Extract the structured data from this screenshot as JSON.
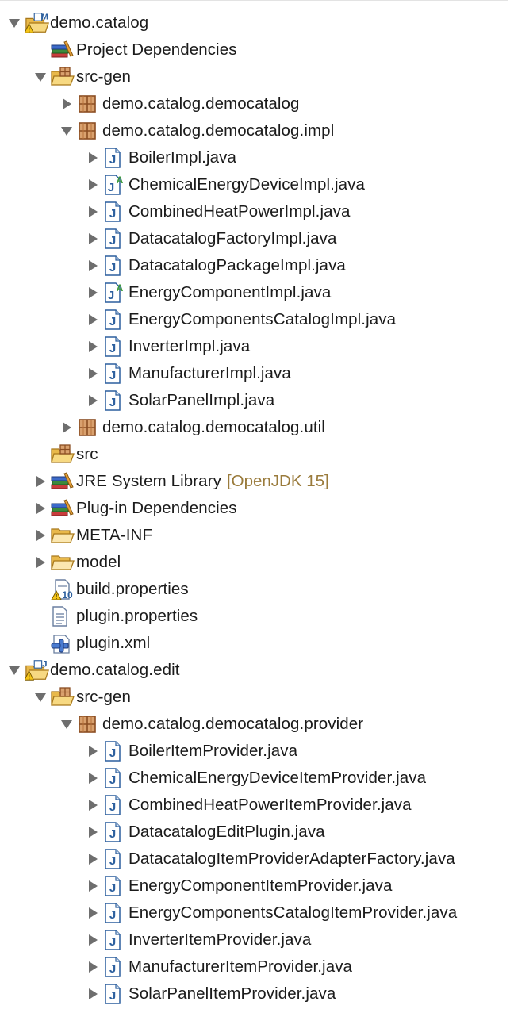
{
  "tree": {
    "rows": [
      {
        "depth": 0,
        "state": "open",
        "icon": "plugin-project-warning-m-icon",
        "label": "demo.catalog"
      },
      {
        "depth": 1,
        "state": "none",
        "icon": "library-icon",
        "label": "Project Dependencies"
      },
      {
        "depth": 1,
        "state": "open",
        "icon": "source-folder-open-icon",
        "label": "src-gen"
      },
      {
        "depth": 2,
        "state": "closed",
        "icon": "package-icon",
        "label": "demo.catalog.democatalog"
      },
      {
        "depth": 2,
        "state": "open",
        "icon": "package-icon",
        "label": "demo.catalog.democatalog.impl"
      },
      {
        "depth": 3,
        "state": "closed",
        "icon": "java-file-icon",
        "label": "BoilerImpl.java"
      },
      {
        "depth": 3,
        "state": "closed",
        "icon": "java-abstract-file-icon",
        "label": "ChemicalEnergyDeviceImpl.java"
      },
      {
        "depth": 3,
        "state": "closed",
        "icon": "java-file-icon",
        "label": "CombinedHeatPowerImpl.java"
      },
      {
        "depth": 3,
        "state": "closed",
        "icon": "java-file-icon",
        "label": "DatacatalogFactoryImpl.java"
      },
      {
        "depth": 3,
        "state": "closed",
        "icon": "java-file-icon",
        "label": "DatacatalogPackageImpl.java"
      },
      {
        "depth": 3,
        "state": "closed",
        "icon": "java-abstract-file-icon",
        "label": "EnergyComponentImpl.java"
      },
      {
        "depth": 3,
        "state": "closed",
        "icon": "java-file-icon",
        "label": "EnergyComponentsCatalogImpl.java"
      },
      {
        "depth": 3,
        "state": "closed",
        "icon": "java-file-icon",
        "label": "InverterImpl.java"
      },
      {
        "depth": 3,
        "state": "closed",
        "icon": "java-file-icon",
        "label": "ManufacturerImpl.java"
      },
      {
        "depth": 3,
        "state": "closed",
        "icon": "java-file-icon",
        "label": "SolarPanelImpl.java"
      },
      {
        "depth": 2,
        "state": "closed",
        "icon": "package-icon",
        "label": "demo.catalog.democatalog.util"
      },
      {
        "depth": 1,
        "state": "none",
        "icon": "source-folder-open-icon",
        "label": "src"
      },
      {
        "depth": 1,
        "state": "closed",
        "icon": "library-icon",
        "label": "JRE System Library",
        "decoration": "[OpenJDK 15]"
      },
      {
        "depth": 1,
        "state": "closed",
        "icon": "library-icon",
        "label": "Plug-in Dependencies"
      },
      {
        "depth": 1,
        "state": "closed",
        "icon": "folder-open-icon",
        "label": "META-INF"
      },
      {
        "depth": 1,
        "state": "closed",
        "icon": "folder-open-icon",
        "label": "model"
      },
      {
        "depth": 1,
        "state": "none",
        "icon": "properties-warning-file-icon",
        "label": "build.properties"
      },
      {
        "depth": 1,
        "state": "none",
        "icon": "properties-file-icon",
        "label": "plugin.properties"
      },
      {
        "depth": 1,
        "state": "none",
        "icon": "plugin-xml-icon",
        "label": "plugin.xml"
      },
      {
        "depth": 0,
        "state": "open",
        "icon": "plugin-project-warning-j-icon",
        "label": "demo.catalog.edit"
      },
      {
        "depth": 1,
        "state": "open",
        "icon": "source-folder-open-icon",
        "label": "src-gen"
      },
      {
        "depth": 2,
        "state": "open",
        "icon": "package-icon",
        "label": "demo.catalog.democatalog.provider"
      },
      {
        "depth": 3,
        "state": "closed",
        "icon": "java-file-icon",
        "label": "BoilerItemProvider.java"
      },
      {
        "depth": 3,
        "state": "closed",
        "icon": "java-file-icon",
        "label": "ChemicalEnergyDeviceItemProvider.java"
      },
      {
        "depth": 3,
        "state": "closed",
        "icon": "java-file-icon",
        "label": "CombinedHeatPowerItemProvider.java"
      },
      {
        "depth": 3,
        "state": "closed",
        "icon": "java-file-icon",
        "label": "DatacatalogEditPlugin.java"
      },
      {
        "depth": 3,
        "state": "closed",
        "icon": "java-file-icon",
        "label": "DatacatalogItemProviderAdapterFactory.java"
      },
      {
        "depth": 3,
        "state": "closed",
        "icon": "java-file-icon",
        "label": "EnergyComponentItemProvider.java"
      },
      {
        "depth": 3,
        "state": "closed",
        "icon": "java-file-icon",
        "label": "EnergyComponentsCatalogItemProvider.java"
      },
      {
        "depth": 3,
        "state": "closed",
        "icon": "java-file-icon",
        "label": "InverterItemProvider.java"
      },
      {
        "depth": 3,
        "state": "closed",
        "icon": "java-file-icon",
        "label": "ManufacturerItemProvider.java"
      },
      {
        "depth": 3,
        "state": "closed",
        "icon": "java-file-icon",
        "label": "SolarPanelItemProvider.java"
      }
    ]
  },
  "colors": {
    "twistie": "#6e6e6e",
    "decoration": "#9a7b3c",
    "java_blue": "#2c5f9e",
    "package_brown": "#9c5a2c",
    "folder_yellow": "#f0c65a",
    "warning_yellow": "#f5c518"
  }
}
